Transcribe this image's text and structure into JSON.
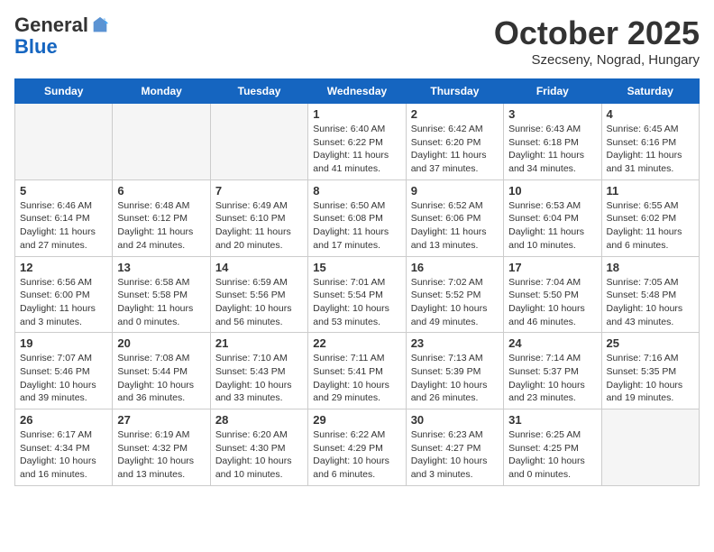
{
  "header": {
    "logo_general": "General",
    "logo_blue": "Blue",
    "calendar_title": "October 2025",
    "calendar_subtitle": "Szecseny, Nograd, Hungary"
  },
  "weekdays": [
    "Sunday",
    "Monday",
    "Tuesday",
    "Wednesday",
    "Thursday",
    "Friday",
    "Saturday"
  ],
  "weeks": [
    [
      {
        "day": "",
        "info": ""
      },
      {
        "day": "",
        "info": ""
      },
      {
        "day": "",
        "info": ""
      },
      {
        "day": "1",
        "info": "Sunrise: 6:40 AM\nSunset: 6:22 PM\nDaylight: 11 hours\nand 41 minutes."
      },
      {
        "day": "2",
        "info": "Sunrise: 6:42 AM\nSunset: 6:20 PM\nDaylight: 11 hours\nand 37 minutes."
      },
      {
        "day": "3",
        "info": "Sunrise: 6:43 AM\nSunset: 6:18 PM\nDaylight: 11 hours\nand 34 minutes."
      },
      {
        "day": "4",
        "info": "Sunrise: 6:45 AM\nSunset: 6:16 PM\nDaylight: 11 hours\nand 31 minutes."
      }
    ],
    [
      {
        "day": "5",
        "info": "Sunrise: 6:46 AM\nSunset: 6:14 PM\nDaylight: 11 hours\nand 27 minutes."
      },
      {
        "day": "6",
        "info": "Sunrise: 6:48 AM\nSunset: 6:12 PM\nDaylight: 11 hours\nand 24 minutes."
      },
      {
        "day": "7",
        "info": "Sunrise: 6:49 AM\nSunset: 6:10 PM\nDaylight: 11 hours\nand 20 minutes."
      },
      {
        "day": "8",
        "info": "Sunrise: 6:50 AM\nSunset: 6:08 PM\nDaylight: 11 hours\nand 17 minutes."
      },
      {
        "day": "9",
        "info": "Sunrise: 6:52 AM\nSunset: 6:06 PM\nDaylight: 11 hours\nand 13 minutes."
      },
      {
        "day": "10",
        "info": "Sunrise: 6:53 AM\nSunset: 6:04 PM\nDaylight: 11 hours\nand 10 minutes."
      },
      {
        "day": "11",
        "info": "Sunrise: 6:55 AM\nSunset: 6:02 PM\nDaylight: 11 hours\nand 6 minutes."
      }
    ],
    [
      {
        "day": "12",
        "info": "Sunrise: 6:56 AM\nSunset: 6:00 PM\nDaylight: 11 hours\nand 3 minutes."
      },
      {
        "day": "13",
        "info": "Sunrise: 6:58 AM\nSunset: 5:58 PM\nDaylight: 11 hours\nand 0 minutes."
      },
      {
        "day": "14",
        "info": "Sunrise: 6:59 AM\nSunset: 5:56 PM\nDaylight: 10 hours\nand 56 minutes."
      },
      {
        "day": "15",
        "info": "Sunrise: 7:01 AM\nSunset: 5:54 PM\nDaylight: 10 hours\nand 53 minutes."
      },
      {
        "day": "16",
        "info": "Sunrise: 7:02 AM\nSunset: 5:52 PM\nDaylight: 10 hours\nand 49 minutes."
      },
      {
        "day": "17",
        "info": "Sunrise: 7:04 AM\nSunset: 5:50 PM\nDaylight: 10 hours\nand 46 minutes."
      },
      {
        "day": "18",
        "info": "Sunrise: 7:05 AM\nSunset: 5:48 PM\nDaylight: 10 hours\nand 43 minutes."
      }
    ],
    [
      {
        "day": "19",
        "info": "Sunrise: 7:07 AM\nSunset: 5:46 PM\nDaylight: 10 hours\nand 39 minutes."
      },
      {
        "day": "20",
        "info": "Sunrise: 7:08 AM\nSunset: 5:44 PM\nDaylight: 10 hours\nand 36 minutes."
      },
      {
        "day": "21",
        "info": "Sunrise: 7:10 AM\nSunset: 5:43 PM\nDaylight: 10 hours\nand 33 minutes."
      },
      {
        "day": "22",
        "info": "Sunrise: 7:11 AM\nSunset: 5:41 PM\nDaylight: 10 hours\nand 29 minutes."
      },
      {
        "day": "23",
        "info": "Sunrise: 7:13 AM\nSunset: 5:39 PM\nDaylight: 10 hours\nand 26 minutes."
      },
      {
        "day": "24",
        "info": "Sunrise: 7:14 AM\nSunset: 5:37 PM\nDaylight: 10 hours\nand 23 minutes."
      },
      {
        "day": "25",
        "info": "Sunrise: 7:16 AM\nSunset: 5:35 PM\nDaylight: 10 hours\nand 19 minutes."
      }
    ],
    [
      {
        "day": "26",
        "info": "Sunrise: 6:17 AM\nSunset: 4:34 PM\nDaylight: 10 hours\nand 16 minutes."
      },
      {
        "day": "27",
        "info": "Sunrise: 6:19 AM\nSunset: 4:32 PM\nDaylight: 10 hours\nand 13 minutes."
      },
      {
        "day": "28",
        "info": "Sunrise: 6:20 AM\nSunset: 4:30 PM\nDaylight: 10 hours\nand 10 minutes."
      },
      {
        "day": "29",
        "info": "Sunrise: 6:22 AM\nSunset: 4:29 PM\nDaylight: 10 hours\nand 6 minutes."
      },
      {
        "day": "30",
        "info": "Sunrise: 6:23 AM\nSunset: 4:27 PM\nDaylight: 10 hours\nand 3 minutes."
      },
      {
        "day": "31",
        "info": "Sunrise: 6:25 AM\nSunset: 4:25 PM\nDaylight: 10 hours\nand 0 minutes."
      },
      {
        "day": "",
        "info": ""
      }
    ]
  ]
}
